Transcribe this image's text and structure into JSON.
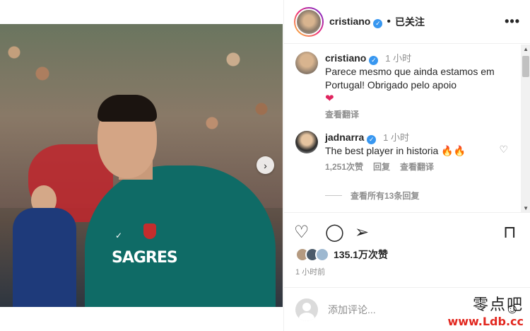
{
  "post": {
    "username": "cristiano",
    "follow_status": "已关注",
    "more": "•••",
    "sponsor_text": "SAGRES",
    "likes": "135.1万次赞",
    "time": "1 小时前"
  },
  "comments": [
    {
      "user": "cristiano",
      "time": "1 小时",
      "text": "Parece mesmo que ainda estamos em Portugal! Obrigado pelo apoio",
      "translate": "查看翻译"
    },
    {
      "user": "jadnarra",
      "time": "1 小时",
      "text": "The best player in historia 🔥🔥",
      "likes": "1,251次赞",
      "reply": "回复",
      "translate": "查看翻译"
    }
  ],
  "view_replies": "查看所有13条回复",
  "add_comment": {
    "placeholder": "添加评论..."
  },
  "watermark": {
    "cn": "零点吧",
    "url": "www.Ldb.cc"
  },
  "colors": {
    "verified": "#3897f0",
    "link_gray": "#8e8e8e",
    "heart": "#e0245e"
  }
}
